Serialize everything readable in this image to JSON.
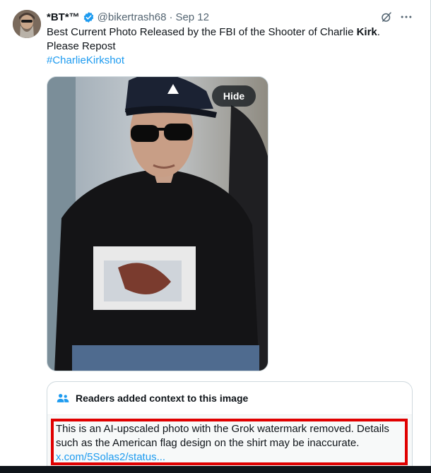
{
  "tweet": {
    "display_name": "*BT*™",
    "handle": "@bikertrash68",
    "separator": "·",
    "date": "Sep 12",
    "text_part1": "Best Current Photo Released by the FBI of the Shooter of Charlie ",
    "text_bold": "Kirk",
    "text_part2": ". Please Repost",
    "hashtag": "#CharlieKirkshot"
  },
  "media": {
    "hide_label": "Hide"
  },
  "community_note": {
    "title": "Readers added context to this image",
    "body": "This is an AI-upscaled photo with the Grok watermark removed. Details such as the American flag design on the shirt may be inaccurate.",
    "link": "x.com/5Solas2/status..."
  },
  "colors": {
    "accent": "#1d9bf0",
    "verified": "#1d9bf0",
    "highlight_box": "#e00000"
  },
  "icons": [
    "verified-badge-icon",
    "grok-icon",
    "more-icon",
    "people-icon"
  ]
}
